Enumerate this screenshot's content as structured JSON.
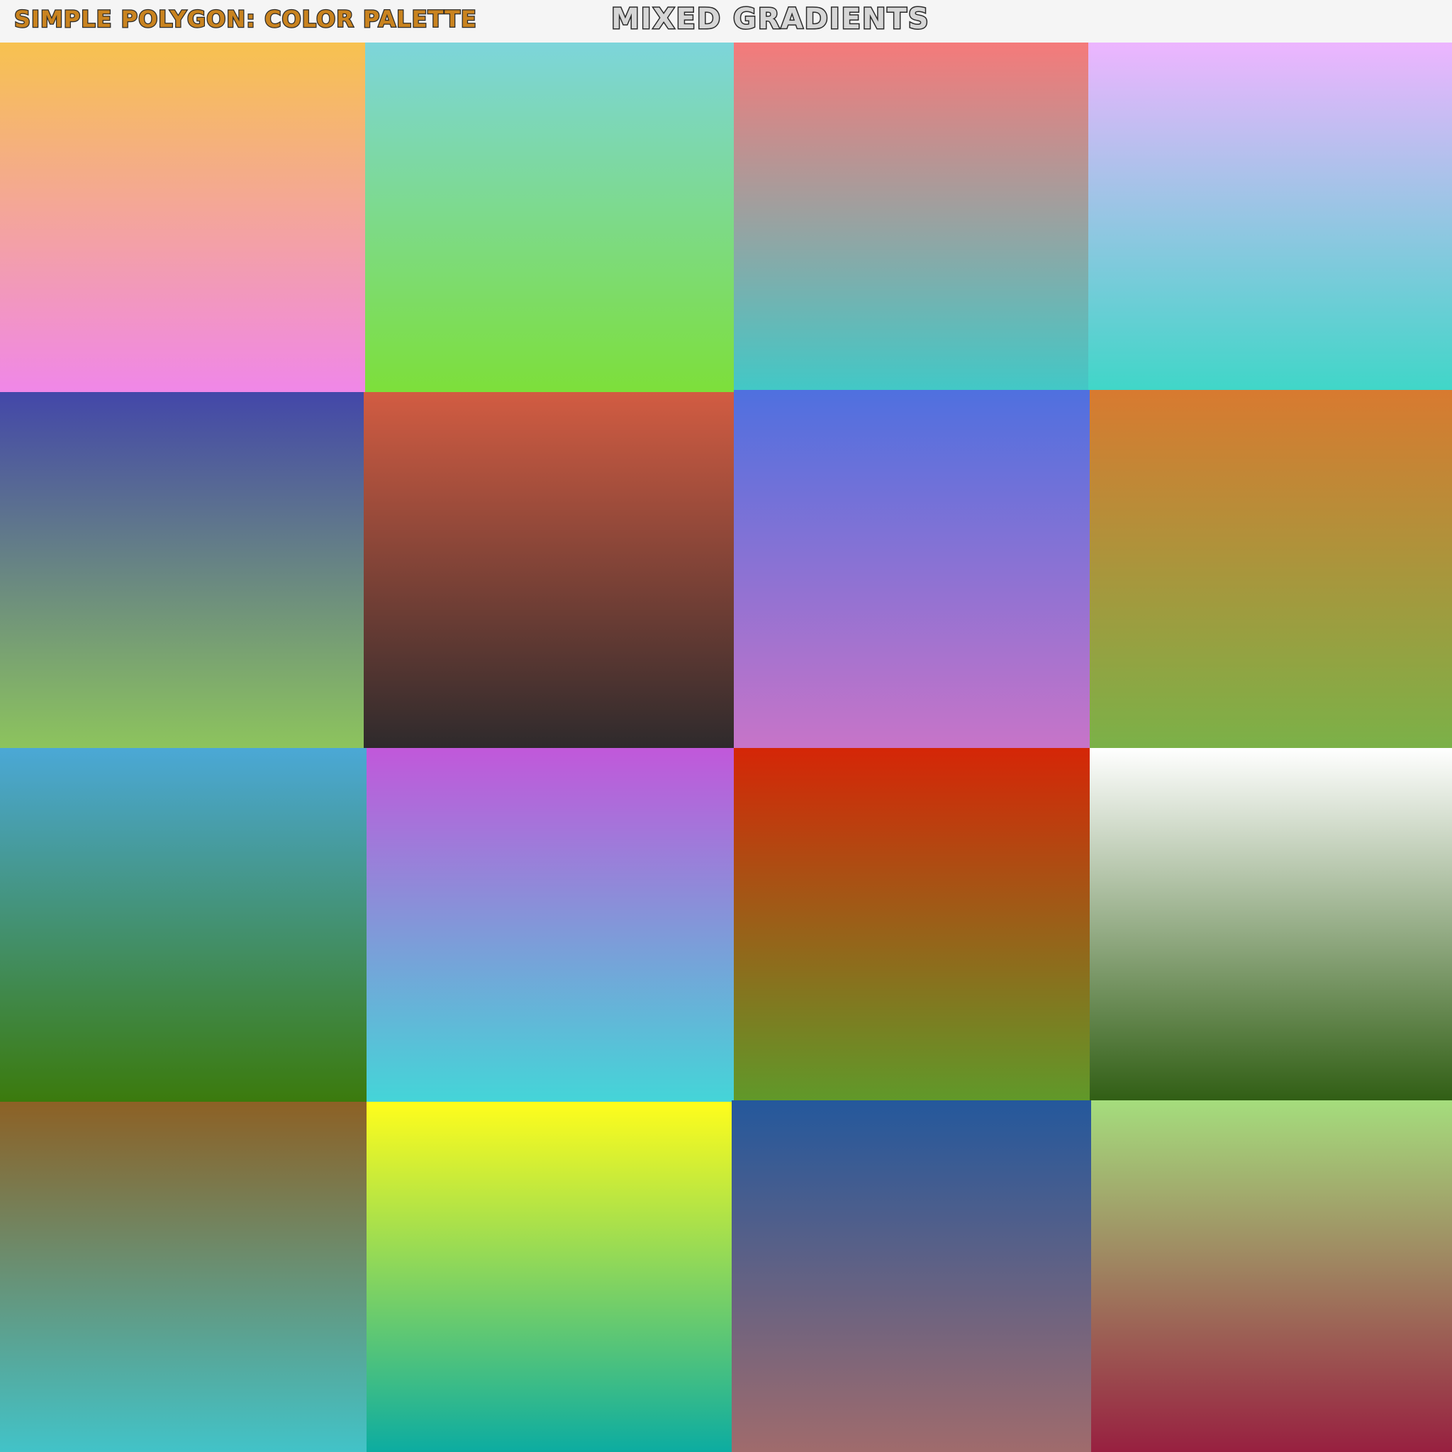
{
  "header": {
    "brand_title": "SIMPLE POLYGON: COLOR PALETTE",
    "page_title": "MIXED GRADIENTS",
    "brand_color": "#c9831f",
    "title_fill": "#d6d6d6",
    "outline_color": "#2a2a2a"
  },
  "swatches": [
    {
      "top": "#f7c24f",
      "bottom": "#f087e8"
    },
    {
      "top": "#7dd5db",
      "bottom": "#7ddf3a"
    },
    {
      "top": "#f57a7a",
      "bottom": "#42c8c6"
    },
    {
      "top": "#edb5ff",
      "bottom": "#40d6c8"
    },
    {
      "top": "#4347a9",
      "bottom": "#8dc45d"
    },
    {
      "top": "#d25c42",
      "bottom": "#2e2a2c"
    },
    {
      "top": "#4f70df",
      "bottom": "#c774c8"
    },
    {
      "top": "#d87a30",
      "bottom": "#7bb148"
    },
    {
      "top": "#4ba8d6",
      "bottom": "#3b7a0b"
    },
    {
      "top": "#c158da",
      "bottom": "#43d6d8"
    },
    {
      "top": "#d52607",
      "bottom": "#5f9a2a"
    },
    {
      "top": "#ffffff",
      "bottom": "#2f5d12"
    },
    {
      "top": "#8d6125",
      "bottom": "#42c3c8"
    },
    {
      "top": "#fffd1c",
      "bottom": "#0caca1"
    },
    {
      "top": "#24589c",
      "bottom": "#a06b6c"
    },
    {
      "top": "#a5dd7d",
      "bottom": "#982040"
    }
  ]
}
